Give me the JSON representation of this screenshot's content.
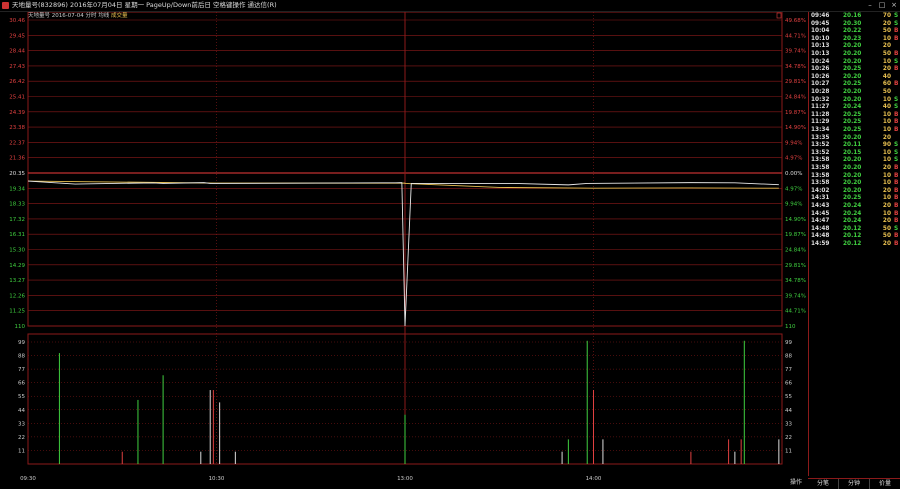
{
  "window": {
    "title": "天地量号(832896) 2016年07月04日 星期一 PageUp/Down前后日 空格键操作 通达信(R)",
    "subtitle_prefix": "天地量号",
    "subtitle_mid": "2016-07-04 分时 均线",
    "subtitle_vol": "成交量"
  },
  "colors": {
    "up": "#e04040",
    "down": "#40d040",
    "grid": "#8b1a1a",
    "price_line": "#e8e8e8",
    "avg_line": "#e8c050"
  },
  "price_axis": {
    "labels": [
      "30.46",
      "29.45",
      "28.44",
      "27.43",
      "26.42",
      "25.41",
      "24.39",
      "23.38",
      "22.37",
      "21.36",
      "20.35",
      "19.34",
      "18.33",
      "17.32",
      "16.31",
      "15.30",
      "14.29",
      "13.27",
      "12.26",
      "11.25",
      "110"
    ],
    "pct_labels": [
      "49.68%",
      "44.71%",
      "39.74%",
      "34.78%",
      "29.81%",
      "24.84%",
      "19.87%",
      "14.90%",
      "9.94%",
      "4.97%",
      "0.00%",
      "4.97%",
      "9.94%",
      "14.90%",
      "19.87%",
      "24.84%",
      "29.81%",
      "34.78%",
      "39.74%",
      "44.71%",
      "110"
    ],
    "ylim": [
      11.25,
      30.46
    ],
    "prev_close": 20.35
  },
  "volume_axis": {
    "labels": [
      "99",
      "88",
      "77",
      "66",
      "55",
      "44",
      "33",
      "22",
      "11"
    ],
    "ylim": [
      0,
      110
    ]
  },
  "time_axis": {
    "labels": [
      "09:30",
      "10:30",
      "13:00",
      "14:00"
    ]
  },
  "chart_data": {
    "type": "line",
    "price_series": {
      "name": "分时",
      "x": [
        "09:30",
        "09:45",
        "10:04",
        "10:10",
        "10:13",
        "10:26",
        "10:28",
        "11:27",
        "11:29",
        "13:00",
        "13:02",
        "13:35",
        "13:52",
        "13:58",
        "14:31",
        "14:45",
        "14:59"
      ],
      "y": [
        20.35,
        20.16,
        20.22,
        20.23,
        20.2,
        20.25,
        20.2,
        20.24,
        20.25,
        11.25,
        20.2,
        20.2,
        20.11,
        20.2,
        20.25,
        20.24,
        20.12
      ]
    },
    "avg_series": {
      "name": "均线",
      "x": [
        "09:30",
        "10:30",
        "11:30",
        "13:00",
        "13:30",
        "14:00",
        "14:30",
        "14:59"
      ],
      "y": [
        20.35,
        20.22,
        20.22,
        20.2,
        19.95,
        19.9,
        19.92,
        19.9
      ]
    },
    "volume": [
      {
        "t": "09:40",
        "v": 90,
        "dir": "down"
      },
      {
        "t": "10:00",
        "v": 10,
        "dir": "up"
      },
      {
        "t": "10:05",
        "v": 52,
        "dir": "down"
      },
      {
        "t": "10:13",
        "v": 72,
        "dir": "down"
      },
      {
        "t": "10:25",
        "v": 10,
        "dir": "flat"
      },
      {
        "t": "10:28",
        "v": 60,
        "dir": "flat"
      },
      {
        "t": "10:29",
        "v": 60,
        "dir": "up"
      },
      {
        "t": "10:31",
        "v": 50,
        "dir": "flat"
      },
      {
        "t": "10:36",
        "v": 10,
        "dir": "flat"
      },
      {
        "t": "13:00",
        "v": 40,
        "dir": "down"
      },
      {
        "t": "13:50",
        "v": 10,
        "dir": "flat"
      },
      {
        "t": "13:52",
        "v": 20,
        "dir": "down"
      },
      {
        "t": "13:58",
        "v": 100,
        "dir": "down"
      },
      {
        "t": "14:00",
        "v": 60,
        "dir": "up"
      },
      {
        "t": "14:03",
        "v": 20,
        "dir": "flat"
      },
      {
        "t": "14:31",
        "v": 10,
        "dir": "up"
      },
      {
        "t": "14:43",
        "v": 20,
        "dir": "up"
      },
      {
        "t": "14:45",
        "v": 10,
        "dir": "flat"
      },
      {
        "t": "14:47",
        "v": 20,
        "dir": "up"
      },
      {
        "t": "14:48",
        "v": 100,
        "dir": "down"
      },
      {
        "t": "14:59",
        "v": 20,
        "dir": "flat"
      }
    ]
  },
  "trades": [
    {
      "time": "09:46",
      "price": "20.16",
      "vol": "70",
      "bs": "S",
      "dir": "down"
    },
    {
      "time": "09:45",
      "price": "20.30",
      "vol": "20",
      "bs": "S",
      "dir": "down"
    },
    {
      "time": "10:04",
      "price": "20.22",
      "vol": "50",
      "bs": "B",
      "dir": "down"
    },
    {
      "time": "10:10",
      "price": "20.23",
      "vol": "10",
      "bs": "B",
      "dir": "down"
    },
    {
      "time": "10:13",
      "price": "20.20",
      "vol": "20",
      "bs": "",
      "dir": "down"
    },
    {
      "time": "10:13",
      "price": "20.20",
      "vol": "50",
      "bs": "B",
      "dir": "down"
    },
    {
      "time": "10:24",
      "price": "20.20",
      "vol": "10",
      "bs": "S",
      "dir": "down"
    },
    {
      "time": "10:26",
      "price": "20.25",
      "vol": "20",
      "bs": "B",
      "dir": "down"
    },
    {
      "time": "10:26",
      "price": "20.20",
      "vol": "40",
      "bs": "",
      "dir": "down"
    },
    {
      "time": "10:27",
      "price": "20.25",
      "vol": "60",
      "bs": "B",
      "dir": "down"
    },
    {
      "time": "10:28",
      "price": "20.20",
      "vol": "50",
      "bs": "",
      "dir": "down"
    },
    {
      "time": "10:32",
      "price": "20.20",
      "vol": "10",
      "bs": "S",
      "dir": "down"
    },
    {
      "time": "11:27",
      "price": "20.24",
      "vol": "40",
      "bs": "S",
      "dir": "down"
    },
    {
      "time": "11:28",
      "price": "20.25",
      "vol": "10",
      "bs": "B",
      "dir": "down"
    },
    {
      "time": "11:29",
      "price": "20.25",
      "vol": "10",
      "bs": "B",
      "dir": "down"
    },
    {
      "time": "13:34",
      "price": "20.25",
      "vol": "10",
      "bs": "B",
      "dir": "down"
    },
    {
      "time": "13:35",
      "price": "20.20",
      "vol": "20",
      "bs": "",
      "dir": "down"
    },
    {
      "time": "13:52",
      "price": "20.11",
      "vol": "90",
      "bs": "S",
      "dir": "down"
    },
    {
      "time": "13:52",
      "price": "20.15",
      "vol": "10",
      "bs": "S",
      "dir": "down"
    },
    {
      "time": "13:58",
      "price": "20.20",
      "vol": "10",
      "bs": "S",
      "dir": "down"
    },
    {
      "time": "13:58",
      "price": "20.20",
      "vol": "20",
      "bs": "B",
      "dir": "down"
    },
    {
      "time": "13:58",
      "price": "20.20",
      "vol": "10",
      "bs": "B",
      "dir": "down"
    },
    {
      "time": "13:58",
      "price": "20.20",
      "vol": "10",
      "bs": "B",
      "dir": "down"
    },
    {
      "time": "14:02",
      "price": "20.20",
      "vol": "20",
      "bs": "B",
      "dir": "down"
    },
    {
      "time": "14:31",
      "price": "20.25",
      "vol": "10",
      "bs": "B",
      "dir": "down"
    },
    {
      "time": "14:43",
      "price": "20.24",
      "vol": "20",
      "bs": "B",
      "dir": "down"
    },
    {
      "time": "14:45",
      "price": "20.24",
      "vol": "10",
      "bs": "B",
      "dir": "down"
    },
    {
      "time": "14:47",
      "price": "20.24",
      "vol": "20",
      "bs": "B",
      "dir": "down"
    },
    {
      "time": "14:48",
      "price": "20.12",
      "vol": "50",
      "bs": "S",
      "dir": "down"
    },
    {
      "time": "14:48",
      "price": "20.12",
      "vol": "50",
      "bs": "B",
      "dir": "down"
    },
    {
      "time": "14:59",
      "price": "20.12",
      "vol": "20",
      "bs": "B",
      "dir": "down"
    }
  ],
  "bottom": {
    "op_label": "操作",
    "tabs": [
      "分笔",
      "分钟",
      "价量"
    ]
  }
}
